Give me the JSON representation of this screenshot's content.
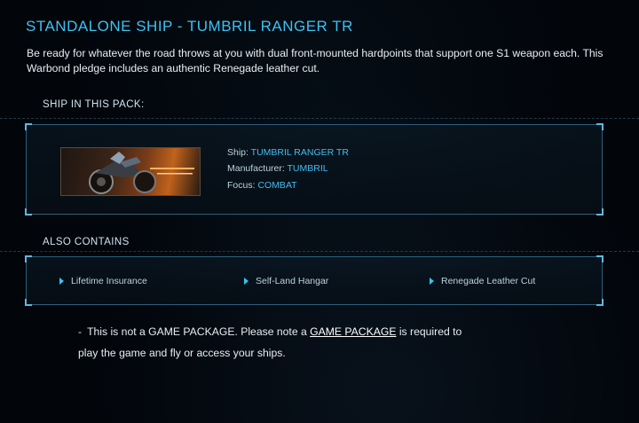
{
  "header": {
    "title": "STANDALONE SHIP - TUMBRIL RANGER TR",
    "description": "Be ready for whatever the road throws at you with dual front-mounted hardpoints that support one S1 weapon each. This Warbond pledge includes an authentic Renegade leather cut."
  },
  "ship_section": {
    "heading": "SHIP IN THIS PACK:",
    "ship_label": "Ship:",
    "ship_value": "TUMBRIL RANGER TR",
    "manufacturer_label": "Manufacturer:",
    "manufacturer_value": "TUMBRIL",
    "focus_label": "Focus:",
    "focus_value": "COMBAT"
  },
  "contains_section": {
    "heading": "ALSO CONTAINS",
    "items": [
      "Lifetime Insurance",
      "Self-Land Hangar",
      "Renegade Leather Cut"
    ]
  },
  "note": {
    "dash": "-",
    "before": "This is not a GAME PACKAGE. Please note a",
    "link": "GAME PACKAGE",
    "after": "is required to play the game and fly or access your ships."
  },
  "colors": {
    "accent": "#3bc2f2",
    "background": "#02050a",
    "panel_border": "#2e5f7c"
  }
}
